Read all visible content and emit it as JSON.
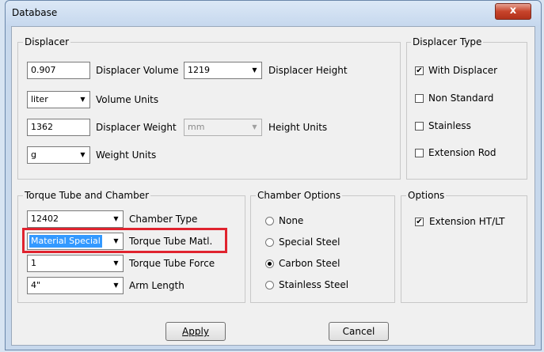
{
  "window": {
    "title": "Database",
    "close_glyph": "x"
  },
  "displacer": {
    "legend": "Displacer",
    "volume_value": "0.907",
    "volume_label": "Displacer Volume",
    "height_value": "1219",
    "height_label": "Displacer Height",
    "volume_units_value": "liter",
    "volume_units_label": "Volume Units",
    "weight_value": "1362",
    "weight_label": "Displacer Weight",
    "height_units_value": "mm",
    "height_units_label": "Height Units",
    "weight_units_value": "g",
    "weight_units_label": "Weight Units"
  },
  "displacer_type": {
    "legend": "Displacer Type",
    "items": [
      {
        "label": "With Displacer",
        "checked": true
      },
      {
        "label": "Non Standard",
        "checked": false
      },
      {
        "label": "Stainless",
        "checked": false
      },
      {
        "label": "Extension Rod",
        "checked": false
      }
    ]
  },
  "torque": {
    "legend": "Torque Tube and Chamber",
    "chamber_type_value": "12402",
    "chamber_type_label": "Chamber Type",
    "matl_value": "Material Special",
    "matl_label": "Torque Tube Matl.",
    "force_value": "1",
    "force_label": "Torque Tube Force",
    "arm_value": "4\"",
    "arm_label": "Arm Length"
  },
  "chamber_options": {
    "legend": "Chamber Options",
    "items": [
      {
        "label": "None",
        "selected": false
      },
      {
        "label": "Special Steel",
        "selected": false
      },
      {
        "label": "Carbon Steel",
        "selected": true
      },
      {
        "label": "Stainless Steel",
        "selected": false
      }
    ]
  },
  "options": {
    "legend": "Options",
    "items": [
      {
        "label": "Extension HT/LT",
        "checked": true
      }
    ]
  },
  "buttons": {
    "apply": "Apply",
    "cancel": "Cancel"
  },
  "icons": {
    "checkmark": "✔",
    "dropdown": "▼"
  },
  "colors": {
    "highlight_box": "#e0232e",
    "selection": "#3399ff"
  }
}
